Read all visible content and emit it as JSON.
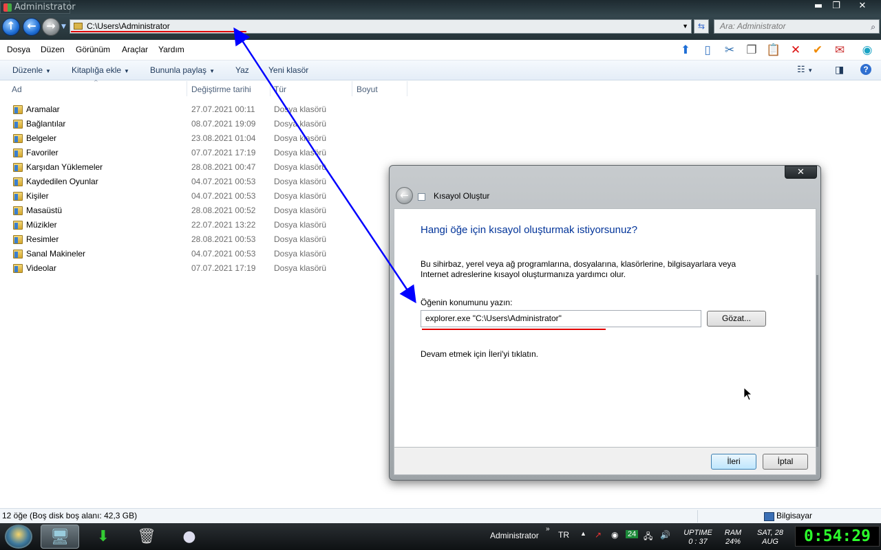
{
  "window": {
    "title": "Administrator",
    "address": "C:\\Users\\Administrator",
    "search_placeholder": "Ara: Administrator",
    "controls": {
      "minimize": "▬",
      "maximize": "❐",
      "close": "✕"
    }
  },
  "menu": [
    "Dosya",
    "Düzen",
    "Görünüm",
    "Araçlar",
    "Yardım"
  ],
  "commands": {
    "organize": "Düzenle",
    "library": "Kitaplığa ekle",
    "share": "Bununla paylaş",
    "burn": "Yaz",
    "new_folder": "Yeni klasör"
  },
  "columns": {
    "name": "Ad",
    "date": "Değiştirme tarihi",
    "type": "Tür",
    "size": "Boyut"
  },
  "files": [
    {
      "name": "Aramalar",
      "date": "27.07.2021 00:11",
      "type": "Dosya klasörü"
    },
    {
      "name": "Bağlantılar",
      "date": "08.07.2021 19:09",
      "type": "Dosya klasörü"
    },
    {
      "name": "Belgeler",
      "date": "23.08.2021 01:04",
      "type": "Dosya klasörü"
    },
    {
      "name": "Favoriler",
      "date": "07.07.2021 17:19",
      "type": "Dosya klasörü"
    },
    {
      "name": "Karşıdan Yüklemeler",
      "date": "28.08.2021 00:47",
      "type": "Dosya klasörü"
    },
    {
      "name": "Kaydedilen Oyunlar",
      "date": "04.07.2021 00:53",
      "type": "Dosya klasörü"
    },
    {
      "name": "Kişiler",
      "date": "04.07.2021 00:53",
      "type": "Dosya klasörü"
    },
    {
      "name": "Masaüstü",
      "date": "28.08.2021 00:52",
      "type": "Dosya klasörü"
    },
    {
      "name": "Müzikler",
      "date": "22.07.2021 13:22",
      "type": "Dosya klasörü"
    },
    {
      "name": "Resimler",
      "date": "28.08.2021 00:53",
      "type": "Dosya klasörü"
    },
    {
      "name": "Sanal Makineler",
      "date": "04.07.2021 00:53",
      "type": "Dosya klasörü"
    },
    {
      "name": "Videolar",
      "date": "07.07.2021 17:19",
      "type": "Dosya klasörü"
    }
  ],
  "status": {
    "count": "12 öğe (Boş disk boş alanı: 42,3 GB)",
    "location": "Bilgisayar"
  },
  "dialog": {
    "title": "Kısayol Oluştur",
    "close": "✕",
    "heading": "Hangi öğe için kısayol oluşturmak istiyorsunuz?",
    "description": "Bu sihirbaz, yerel veya ağ programlarına, dosyalarına, klasörlerine, bilgisayarlara veya Internet adreslerine kısayol oluşturmanıza yardımcı olur.",
    "location_label": "Öğenin konumunu yazın:",
    "location_value": "explorer.exe \"C:\\Users\\Administrator\"",
    "browse": "Gözat...",
    "hint": "Devam etmek için İleri'yi tıklatın.",
    "next": "İleri",
    "cancel": "İptal"
  },
  "taskbar": {
    "user": "Administrator",
    "lang": "TR",
    "badge": "24",
    "uptime_label": "UPTIME",
    "uptime_value": "0 : 37",
    "ram_label": "RAM",
    "ram_value": "24%",
    "date_top": "SAT, 28",
    "date_bottom": "AUG",
    "clock": "0:54:29"
  },
  "colors": {
    "annotation_arrow": "#0000ff",
    "annotation_underline": "#e00000",
    "dialog_heading": "#003399"
  }
}
